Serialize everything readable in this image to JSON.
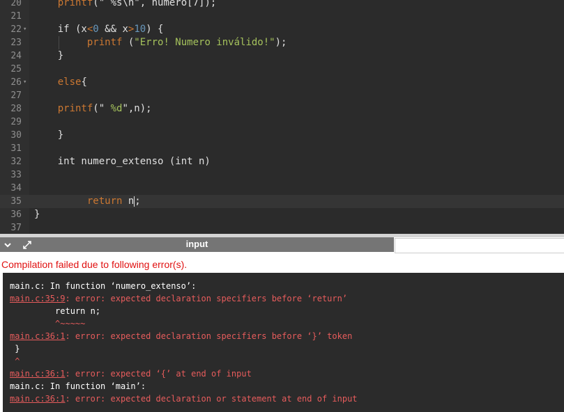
{
  "editor": {
    "lines": [
      {
        "n": "20",
        "fold": "",
        "parts": [
          {
            "t": "    ",
            "c": ""
          },
          {
            "t": "printf",
            "c": "fn"
          },
          {
            "t": "(\" %s\\n\", numero[7]);",
            "c": ""
          }
        ]
      },
      {
        "n": "21",
        "fold": "",
        "parts": []
      },
      {
        "n": "22",
        "fold": "▾",
        "parts": [
          {
            "t": "    if (x",
            "c": ""
          },
          {
            "t": "<",
            "c": "op"
          },
          {
            "t": "0",
            "c": "num"
          },
          {
            "t": " && x",
            "c": ""
          },
          {
            "t": ">",
            "c": "op"
          },
          {
            "t": "10",
            "c": "num"
          },
          {
            "t": ") {",
            "c": ""
          }
        ]
      },
      {
        "n": "23",
        "fold": "",
        "parts": [
          {
            "t": "         ",
            "c": ""
          },
          {
            "t": "printf",
            "c": "fn"
          },
          {
            "t": " (",
            "c": ""
          },
          {
            "t": "\"Erro! Numero inválido!\"",
            "c": "str"
          },
          {
            "t": ");",
            "c": ""
          }
        ]
      },
      {
        "n": "24",
        "fold": "",
        "parts": [
          {
            "t": "    }",
            "c": ""
          }
        ]
      },
      {
        "n": "25",
        "fold": "",
        "parts": []
      },
      {
        "n": "26",
        "fold": "▾",
        "parts": [
          {
            "t": "    ",
            "c": ""
          },
          {
            "t": "else",
            "c": "fn"
          },
          {
            "t": "{",
            "c": ""
          }
        ]
      },
      {
        "n": "27",
        "fold": "",
        "parts": []
      },
      {
        "n": "28",
        "fold": "",
        "parts": [
          {
            "t": "    ",
            "c": ""
          },
          {
            "t": "printf",
            "c": "fn"
          },
          {
            "t": "(\"",
            "c": ""
          },
          {
            "t": " %d",
            "c": "str"
          },
          {
            "t": "\",n);",
            "c": ""
          }
        ]
      },
      {
        "n": "29",
        "fold": "",
        "parts": []
      },
      {
        "n": "30",
        "fold": "",
        "parts": [
          {
            "t": "    }",
            "c": ""
          }
        ]
      },
      {
        "n": "31",
        "fold": "",
        "parts": []
      },
      {
        "n": "32",
        "fold": "",
        "parts": [
          {
            "t": "    int numero_extenso (int n)",
            "c": ""
          }
        ]
      },
      {
        "n": "33",
        "fold": "",
        "parts": []
      },
      {
        "n": "34",
        "fold": "",
        "parts": []
      },
      {
        "n": "35",
        "fold": "",
        "active": true,
        "parts": [
          {
            "t": "         ",
            "c": ""
          },
          {
            "t": "return",
            "c": "fn"
          },
          {
            "t": " n",
            "c": ""
          },
          {
            "t": "|",
            "c": "cursor"
          },
          {
            "t": ";",
            "c": ""
          }
        ]
      },
      {
        "n": "36",
        "fold": "",
        "parts": [
          {
            "t": "}",
            "c": ""
          }
        ]
      },
      {
        "n": "37",
        "fold": "",
        "parts": []
      }
    ]
  },
  "io": {
    "tab_label": "input",
    "collapse_icon": "chevron-down-icon",
    "expand_icon": "expand-arrows-icon",
    "input_value": ""
  },
  "status": {
    "message": "Compilation failed due to following error(s)."
  },
  "output": {
    "lines": [
      [
        {
          "t": "main.c: In function ‘numero_extenso’:",
          "c": ""
        }
      ],
      [
        {
          "t": "main.c:35:9",
          "c": "loc"
        },
        {
          "t": ": error: expected declaration specifiers before ‘return’",
          "c": "err"
        }
      ],
      [
        {
          "t": "         return n;",
          "c": ""
        }
      ],
      [
        {
          "t": "         ^~~~~~",
          "c": "caret"
        }
      ],
      [
        {
          "t": "main.c:36:1",
          "c": "loc"
        },
        {
          "t": ": error: expected declaration specifiers before ‘}’ token",
          "c": "err"
        }
      ],
      [
        {
          "t": " }",
          "c": ""
        }
      ],
      [
        {
          "t": " ^",
          "c": "caret"
        }
      ],
      [
        {
          "t": "main.c:36:1",
          "c": "loc"
        },
        {
          "t": ": error: expected ‘{’ at end of input",
          "c": "err"
        }
      ],
      [
        {
          "t": "main.c: In function ‘main’:",
          "c": ""
        }
      ],
      [
        {
          "t": "main.c:36:1",
          "c": "loc"
        },
        {
          "t": ": error: expected declaration or statement at end of input",
          "c": "err"
        }
      ]
    ]
  },
  "colors": {
    "editor_bg": "#2b2b2b",
    "function": "#cc7832",
    "string": "#a5c25c",
    "number": "#6897bb",
    "error": "#e75c5c",
    "status_error": "#e01010"
  }
}
